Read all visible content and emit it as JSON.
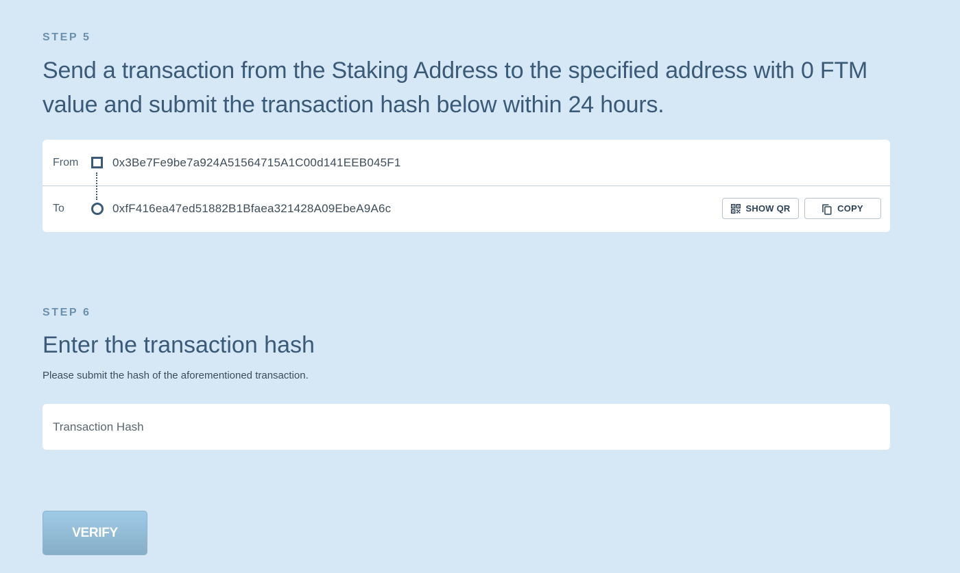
{
  "step5": {
    "label": "STEP 5",
    "title": "Send a transaction from the Staking Address to the specified address with 0 FTM value and submit the transaction hash below within 24 hours."
  },
  "transfer": {
    "from_label": "From",
    "from_address": "0x3Be7Fe9be7a924A51564715A1C00d141EEB045F1",
    "to_label": "To",
    "to_address": "0xfF416ea47ed51882B1Bfaea321428A09EbeA9A6c",
    "show_qr_label": "SHOW QR",
    "copy_label": "COPY",
    "icons": {
      "from": "square-node-icon",
      "to": "circle-node-icon",
      "qr": "qr-code-icon",
      "copy": "copy-icon"
    }
  },
  "step6": {
    "label": "STEP 6",
    "title": "Enter the transaction hash",
    "description": "Please submit the hash of the aforementioned transaction."
  },
  "hash_input": {
    "placeholder": "Transaction Hash",
    "value": ""
  },
  "verify": {
    "label": "VERIFY"
  },
  "colors": {
    "background": "#d6e8f6",
    "heading": "#3b5a78",
    "step_label": "#6a90ad",
    "verify_button": "#93bcd8"
  }
}
